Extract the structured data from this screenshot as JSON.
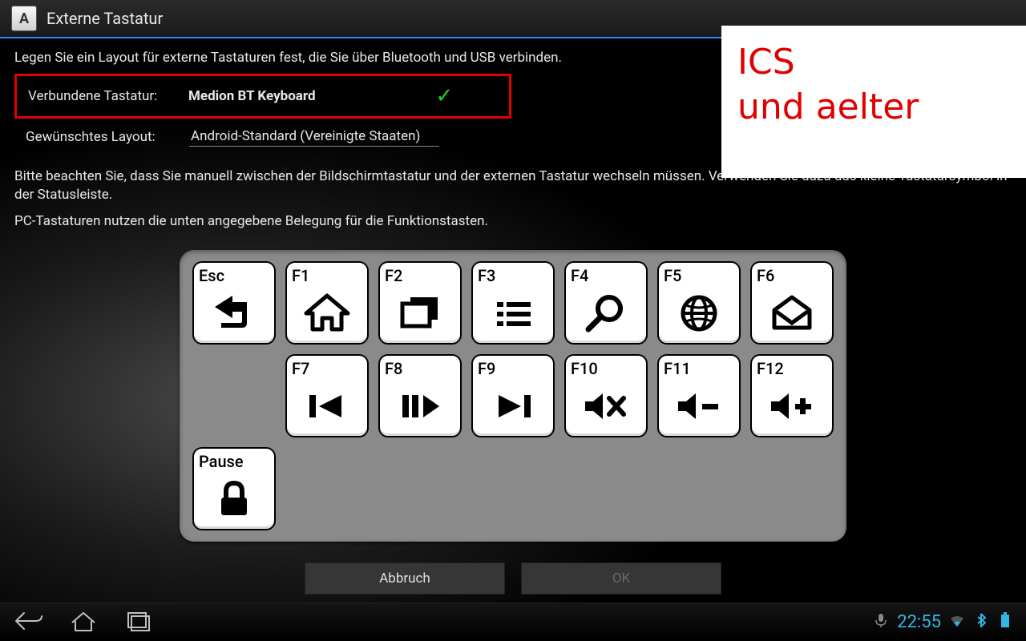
{
  "titlebar": {
    "icon_letter": "A",
    "title": "Externe Tastatur"
  },
  "intro": "Legen Sie ein Layout für externe Tastaturen fest, die Sie über Bluetooth und USB verbinden.",
  "connected": {
    "label": "Verbundene Tastatur:",
    "value": "Medion BT Keyboard"
  },
  "layout": {
    "label": "Gewünschtes Layout:",
    "value": "Android-Standard (Vereinigte Staaten)"
  },
  "note1": "Bitte beachten Sie, dass Sie manuell zwischen der Bildschirmtastatur und der externen Tastatur wechseln müssen. Verwenden Sie dazu das kleine Tastatursymbol in der Statusleiste.",
  "note2": "PC-Tastaturen nutzen die unten angegebene Belegung für die Funktionstasten.",
  "annotation": {
    "line1": "ICS",
    "line2": "und aelter"
  },
  "keys": {
    "esc": "Esc",
    "f1": "F1",
    "f2": "F2",
    "f3": "F3",
    "f4": "F4",
    "f5": "F5",
    "f6": "F6",
    "f7": "F7",
    "f8": "F8",
    "f9": "F9",
    "f10": "F10",
    "f11": "F11",
    "f12": "F12",
    "pause": "Pause"
  },
  "buttons": {
    "cancel": "Abbruch",
    "ok": "OK"
  },
  "statusbar": {
    "time": "22:55"
  }
}
